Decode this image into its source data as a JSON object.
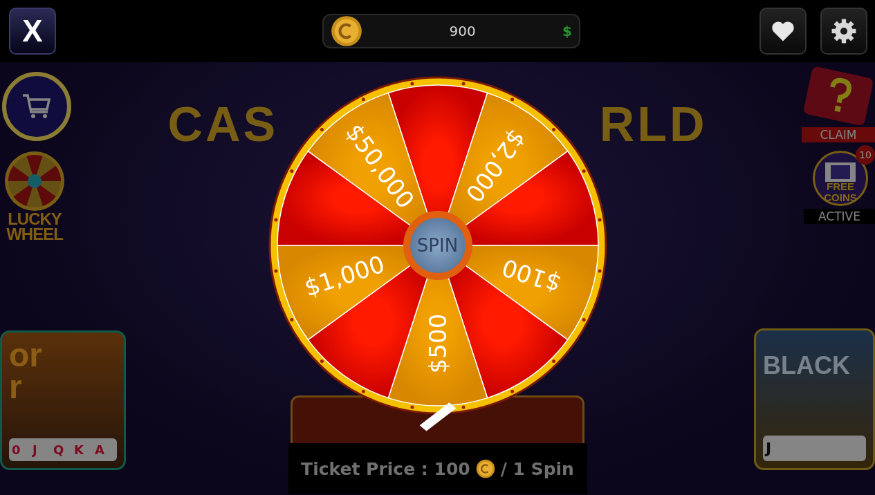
{
  "top_bar": {
    "close_button": "X",
    "balance": {
      "amount": "900",
      "currency": "$"
    }
  },
  "side_left": {
    "lucky_wheel_label": [
      "LUCKY",
      "WHEEL"
    ]
  },
  "side_right": {
    "claim_label": "CLAIM",
    "free_coins": {
      "label": [
        "FREE",
        "COINS"
      ],
      "badge": "10",
      "status": "ACTIVE"
    }
  },
  "background_title": {
    "left": "CAS",
    "right": "RLD"
  },
  "game_cards": [
    {
      "kind": "poker",
      "title": [
        "or",
        "r"
      ],
      "cards": [
        "0",
        "J",
        "Q",
        "K",
        "A"
      ]
    },
    {
      "kind": "blackjack",
      "title": [
        "BLACK"
      ],
      "cards": [
        "J"
      ]
    }
  ],
  "wheel": {
    "spin_button": "SPIN",
    "segments": [
      {
        "kind": "blank"
      },
      {
        "kind": "prize",
        "label": "$2,000"
      },
      {
        "kind": "blank"
      },
      {
        "kind": "prize",
        "label": "$100"
      },
      {
        "kind": "blank"
      },
      {
        "kind": "prize",
        "label": "$500"
      },
      {
        "kind": "blank"
      },
      {
        "kind": "prize",
        "label": "$1,000"
      },
      {
        "kind": "blank"
      },
      {
        "kind": "prize",
        "label": "$50,000"
      }
    ]
  },
  "ticket_price": {
    "prefix": "Ticket Price : 100",
    "suffix": "/ 1 Spin"
  }
}
